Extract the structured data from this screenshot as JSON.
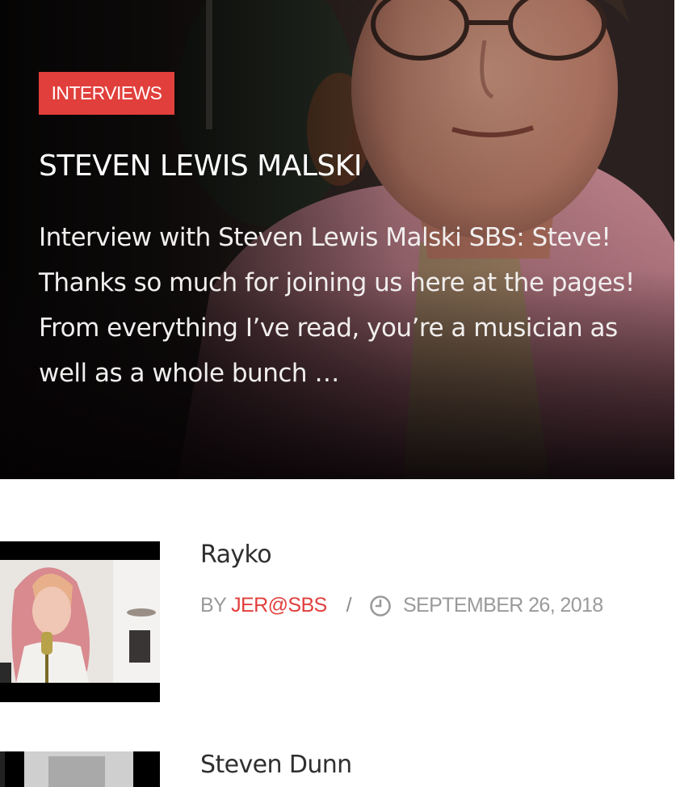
{
  "featured": {
    "category": "INTERVIEWS",
    "title": "STEVEN LEWIS MALSKI",
    "excerpt": "Interview with Steven Lewis Malski SBS: Steve! Thanks so much for joining us here at the pages! From everything I’ve read, you’re a musician as well as a whole bunch …"
  },
  "posts": [
    {
      "title": "Rayko",
      "by_label": "BY",
      "author": "JER@SBS",
      "separator": "/",
      "date": "SEPTEMBER 26, 2018",
      "thumb_icon": "video-still-thumbnail"
    },
    {
      "title": "Steven Dunn",
      "thumb_icon": "photo-thumbnail"
    }
  ],
  "colors": {
    "accent": "#e13f3b",
    "meta_text": "#9a9a9a",
    "title_text": "#2f2f2f"
  }
}
